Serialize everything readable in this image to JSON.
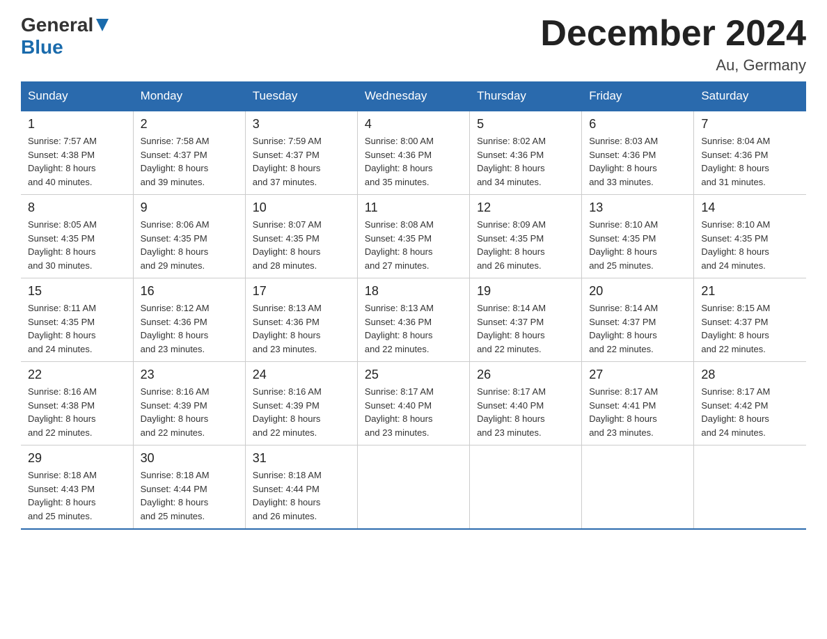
{
  "header": {
    "logo": {
      "general": "General",
      "blue": "Blue"
    },
    "title": "December 2024",
    "location": "Au, Germany"
  },
  "days_of_week": [
    "Sunday",
    "Monday",
    "Tuesday",
    "Wednesday",
    "Thursday",
    "Friday",
    "Saturday"
  ],
  "weeks": [
    [
      {
        "day": "1",
        "sunrise": "7:57 AM",
        "sunset": "4:38 PM",
        "daylight": "8 hours and 40 minutes."
      },
      {
        "day": "2",
        "sunrise": "7:58 AM",
        "sunset": "4:37 PM",
        "daylight": "8 hours and 39 minutes."
      },
      {
        "day": "3",
        "sunrise": "7:59 AM",
        "sunset": "4:37 PM",
        "daylight": "8 hours and 37 minutes."
      },
      {
        "day": "4",
        "sunrise": "8:00 AM",
        "sunset": "4:36 PM",
        "daylight": "8 hours and 35 minutes."
      },
      {
        "day": "5",
        "sunrise": "8:02 AM",
        "sunset": "4:36 PM",
        "daylight": "8 hours and 34 minutes."
      },
      {
        "day": "6",
        "sunrise": "8:03 AM",
        "sunset": "4:36 PM",
        "daylight": "8 hours and 33 minutes."
      },
      {
        "day": "7",
        "sunrise": "8:04 AM",
        "sunset": "4:36 PM",
        "daylight": "8 hours and 31 minutes."
      }
    ],
    [
      {
        "day": "8",
        "sunrise": "8:05 AM",
        "sunset": "4:35 PM",
        "daylight": "8 hours and 30 minutes."
      },
      {
        "day": "9",
        "sunrise": "8:06 AM",
        "sunset": "4:35 PM",
        "daylight": "8 hours and 29 minutes."
      },
      {
        "day": "10",
        "sunrise": "8:07 AM",
        "sunset": "4:35 PM",
        "daylight": "8 hours and 28 minutes."
      },
      {
        "day": "11",
        "sunrise": "8:08 AM",
        "sunset": "4:35 PM",
        "daylight": "8 hours and 27 minutes."
      },
      {
        "day": "12",
        "sunrise": "8:09 AM",
        "sunset": "4:35 PM",
        "daylight": "8 hours and 26 minutes."
      },
      {
        "day": "13",
        "sunrise": "8:10 AM",
        "sunset": "4:35 PM",
        "daylight": "8 hours and 25 minutes."
      },
      {
        "day": "14",
        "sunrise": "8:10 AM",
        "sunset": "4:35 PM",
        "daylight": "8 hours and 24 minutes."
      }
    ],
    [
      {
        "day": "15",
        "sunrise": "8:11 AM",
        "sunset": "4:35 PM",
        "daylight": "8 hours and 24 minutes."
      },
      {
        "day": "16",
        "sunrise": "8:12 AM",
        "sunset": "4:36 PM",
        "daylight": "8 hours and 23 minutes."
      },
      {
        "day": "17",
        "sunrise": "8:13 AM",
        "sunset": "4:36 PM",
        "daylight": "8 hours and 23 minutes."
      },
      {
        "day": "18",
        "sunrise": "8:13 AM",
        "sunset": "4:36 PM",
        "daylight": "8 hours and 22 minutes."
      },
      {
        "day": "19",
        "sunrise": "8:14 AM",
        "sunset": "4:37 PM",
        "daylight": "8 hours and 22 minutes."
      },
      {
        "day": "20",
        "sunrise": "8:14 AM",
        "sunset": "4:37 PM",
        "daylight": "8 hours and 22 minutes."
      },
      {
        "day": "21",
        "sunrise": "8:15 AM",
        "sunset": "4:37 PM",
        "daylight": "8 hours and 22 minutes."
      }
    ],
    [
      {
        "day": "22",
        "sunrise": "8:16 AM",
        "sunset": "4:38 PM",
        "daylight": "8 hours and 22 minutes."
      },
      {
        "day": "23",
        "sunrise": "8:16 AM",
        "sunset": "4:39 PM",
        "daylight": "8 hours and 22 minutes."
      },
      {
        "day": "24",
        "sunrise": "8:16 AM",
        "sunset": "4:39 PM",
        "daylight": "8 hours and 22 minutes."
      },
      {
        "day": "25",
        "sunrise": "8:17 AM",
        "sunset": "4:40 PM",
        "daylight": "8 hours and 23 minutes."
      },
      {
        "day": "26",
        "sunrise": "8:17 AM",
        "sunset": "4:40 PM",
        "daylight": "8 hours and 23 minutes."
      },
      {
        "day": "27",
        "sunrise": "8:17 AM",
        "sunset": "4:41 PM",
        "daylight": "8 hours and 23 minutes."
      },
      {
        "day": "28",
        "sunrise": "8:17 AM",
        "sunset": "4:42 PM",
        "daylight": "8 hours and 24 minutes."
      }
    ],
    [
      {
        "day": "29",
        "sunrise": "8:18 AM",
        "sunset": "4:43 PM",
        "daylight": "8 hours and 25 minutes."
      },
      {
        "day": "30",
        "sunrise": "8:18 AM",
        "sunset": "4:44 PM",
        "daylight": "8 hours and 25 minutes."
      },
      {
        "day": "31",
        "sunrise": "8:18 AM",
        "sunset": "4:44 PM",
        "daylight": "8 hours and 26 minutes."
      },
      null,
      null,
      null,
      null
    ]
  ],
  "labels": {
    "sunrise": "Sunrise:",
    "sunset": "Sunset:",
    "daylight": "Daylight:"
  }
}
